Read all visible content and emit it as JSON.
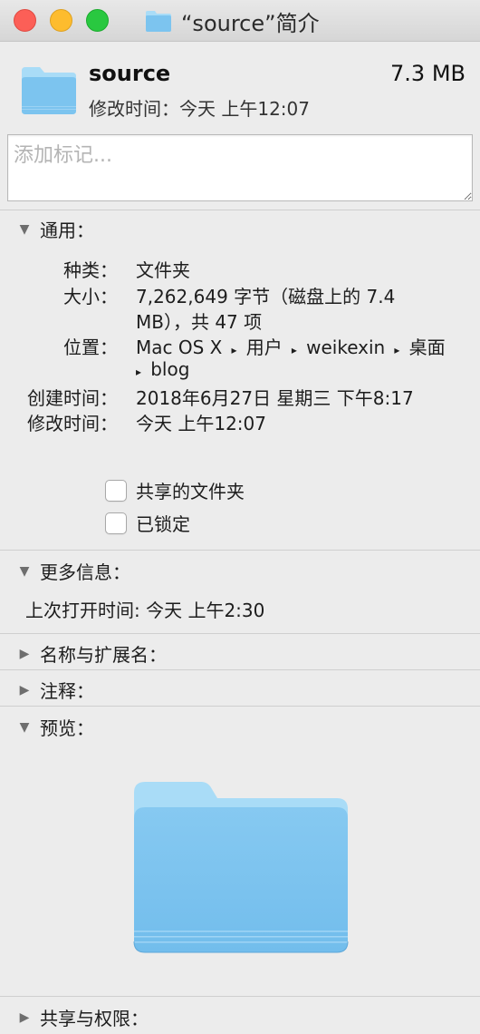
{
  "window": {
    "title": "“source”简介",
    "controls": {
      "close": "close-icon",
      "minimize": "minimize-icon",
      "zoom": "zoom-icon"
    }
  },
  "header": {
    "name": "source",
    "size": "7.3 MB",
    "modified_line": "修改时间：今天 上午12:07",
    "icon": "folder-icon"
  },
  "tags": {
    "placeholder": "添加标记..."
  },
  "general": {
    "heading": "通用：",
    "kind_label": "种类：",
    "kind_value": "文件夹",
    "size_label": "大小：",
    "size_value_1": "7,262,649 字节（磁盘上的 7.4",
    "size_value_2": "MB），共 47 项",
    "where_label": "位置：",
    "where_path_1": [
      "Mac OS X",
      "用户",
      "weikexin",
      "桌面"
    ],
    "where_path_2": [
      "blog"
    ],
    "created_label": "创建时间：",
    "created_value": "2018年6月27日 星期三 下午8:17",
    "modified_label": "修改时间：",
    "modified_value": "今天 上午12:07",
    "shared_folder_label": "共享的文件夹",
    "locked_label": "已锁定"
  },
  "more_info": {
    "heading": "更多信息：",
    "last_opened": "上次打开时间: 今天 上午2:30"
  },
  "name_ext": {
    "heading": "名称与扩展名："
  },
  "comments": {
    "heading": "注释："
  },
  "preview": {
    "heading": "预览："
  },
  "sharing": {
    "heading": "共享与权限："
  },
  "colors": {
    "folder_light": "#a9dcf7",
    "folder_body": "#78c2ef",
    "close": "#fc5f57",
    "minimize": "#fdbc2e",
    "zoom": "#29c840"
  }
}
